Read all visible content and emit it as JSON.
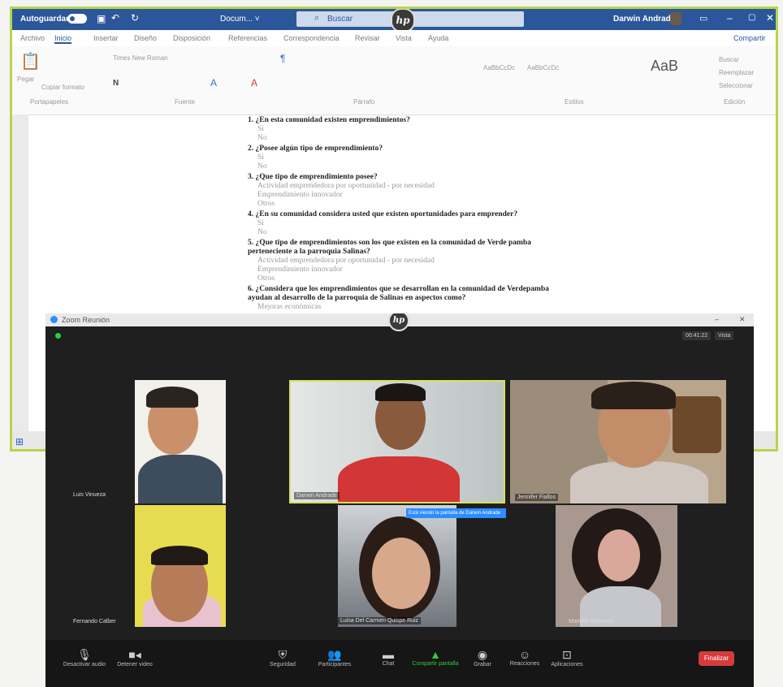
{
  "word": {
    "autosave_label": "Autoguardado",
    "filename": "Docum... ˅",
    "search_placeholder": "Buscar",
    "user_name": "Darwin Andrade",
    "tabs": [
      "Archivo",
      "Inicio",
      "Insertar",
      "Diseño",
      "Disposición",
      "Referencias",
      "Correspondencia",
      "Revisar",
      "Vista",
      "Ayuda"
    ],
    "share_label": "Compartir",
    "ribbon": {
      "font_name": "Times New Roman",
      "paste_label": "Pegar",
      "format_painter": "Copiar formato",
      "clipboard": "Portapapeles",
      "font_group": "Fuente",
      "paragraph": "Párrafo",
      "styles": "Estilos",
      "editing": "Edición",
      "style1": "AaBbCcDc",
      "style2": "AaBbCcDc",
      "style_big": "AaB",
      "find": "Buscar",
      "replace": "Reemplazar",
      "select": "Seleccionar"
    },
    "document": [
      {
        "q": "1. ¿En esta comunidad existen emprendimientos?",
        "opts": [
          "Si",
          "No"
        ]
      },
      {
        "q": "2. ¿Posee algún tipo de emprendimiento?",
        "opts": [
          "Si",
          "No"
        ]
      },
      {
        "q": "3. ¿Que tipo de emprendimiento posee?",
        "opts": [
          "Actividad emprendedora por oportunidad - por necesidad",
          "Emprendimiento innovador",
          "Otros"
        ]
      },
      {
        "q": "4. ¿En su comunidad considera usted que existen oportunidades para emprender?",
        "opts": [
          "Si",
          "No"
        ]
      },
      {
        "q": "5. ¿Que tipo de emprendimientos son los que existen en la comunidad de Verde pamba perteneciente a la parroquia Salinas?",
        "opts": [
          "Actividad emprendedora por oportunidad - por necesidad",
          "Emprendimiento innovador",
          "Otros"
        ]
      },
      {
        "q": "6. ¿Considera que los emprendimientos que se desarrollan en la comunidad de Verdepamba ayudan al desarrollo de la parroquia de Salinas en aspectos como?",
        "opts": [
          "Mejoras económicas"
        ]
      }
    ]
  },
  "zoom": {
    "title": "Zoom Reunión",
    "view_label": "Vista",
    "participants": [
      {
        "name": "Luis Vinueza"
      },
      {
        "name": "Darwin Andrade"
      },
      {
        "name": "Jennifer Fiallos"
      },
      {
        "name": "Fernando Calber"
      },
      {
        "name": "Luisa Del Carmen Quispe Ruiz"
      },
      {
        "name": "Marielle Guerrero"
      }
    ],
    "screen_share_banner": "Está viendo la pantalla de Darwin Andrade",
    "toolbar": [
      {
        "icon": "microphone-icon",
        "label": "Desactivar audio"
      },
      {
        "icon": "video-camera-icon",
        "label": "Detener video"
      },
      {
        "icon": "shield-icon",
        "label": "Seguridad"
      },
      {
        "icon": "participants-icon",
        "label": "Participantes"
      },
      {
        "icon": "chat-icon",
        "label": "Chat"
      },
      {
        "icon": "share-screen-icon",
        "label": "Compartir pantalla"
      },
      {
        "icon": "record-icon",
        "label": "Grabar"
      },
      {
        "icon": "reactions-icon",
        "label": "Reacciones"
      },
      {
        "icon": "apps-icon",
        "label": "Aplicaciones"
      }
    ],
    "end_label": "Finalizar",
    "colors": {
      "active_speaker_border": "#d9e25a",
      "end_button": "#d63b3b",
      "share_green": "#2ecc40"
    }
  }
}
